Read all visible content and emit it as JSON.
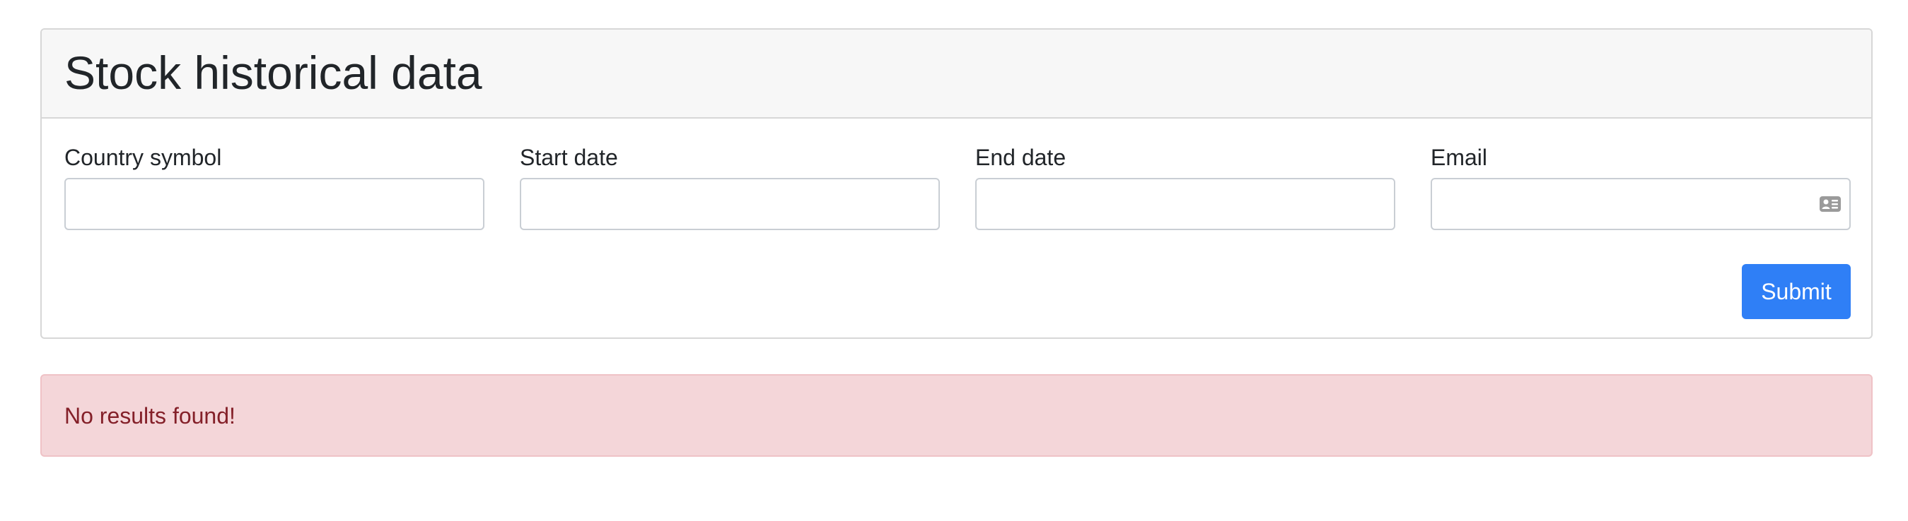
{
  "card": {
    "title": "Stock historical data"
  },
  "form": {
    "fields": [
      {
        "label": "Country symbol",
        "value": "",
        "placeholder": ""
      },
      {
        "label": "Start date",
        "value": "",
        "placeholder": ""
      },
      {
        "label": "End date",
        "value": "",
        "placeholder": ""
      },
      {
        "label": "Email",
        "value": "",
        "placeholder": "",
        "icon": "contact-card-icon"
      }
    ],
    "submit_label": "Submit"
  },
  "alert": {
    "message": "No results found!"
  },
  "colors": {
    "primary": "#2f7ff6",
    "alert_background": "#f4d6d9",
    "alert_text": "#842029",
    "header_background": "#f7f7f7"
  }
}
